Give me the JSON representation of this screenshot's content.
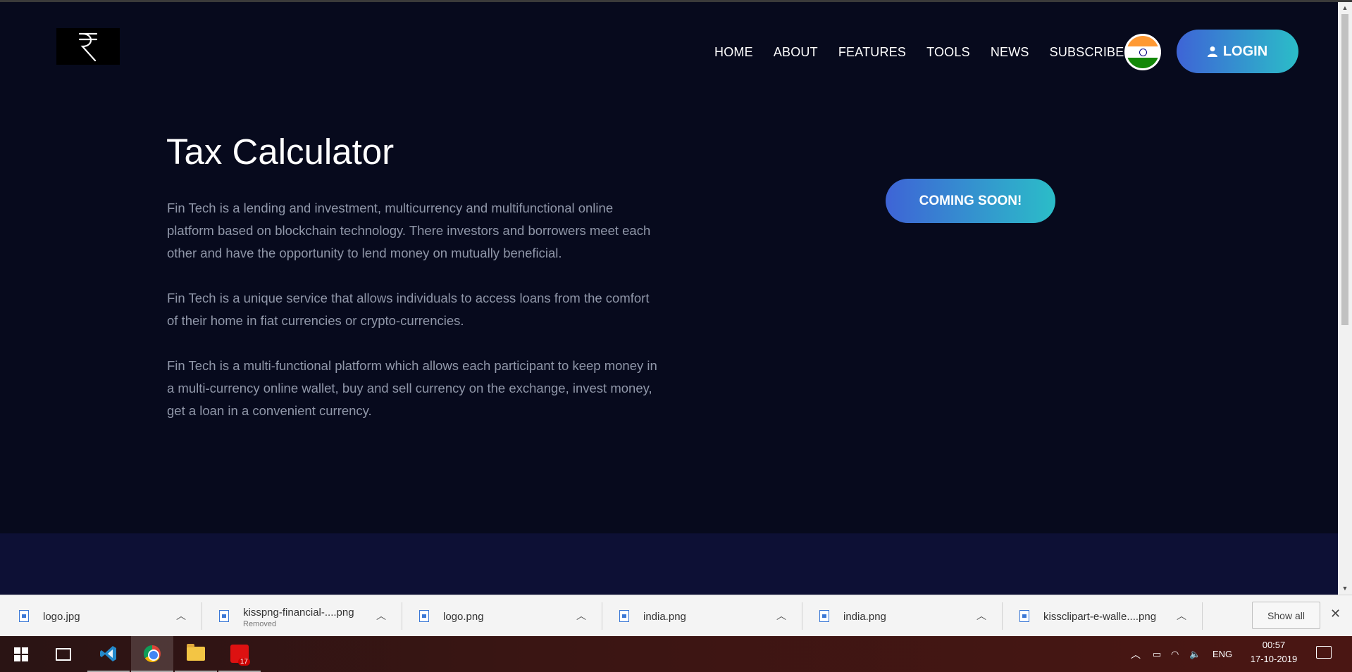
{
  "brand": {
    "logo_symbol": "₹"
  },
  "nav": {
    "items": [
      "HOME",
      "ABOUT",
      "FEATURES",
      "TOOLS",
      "NEWS",
      "SUBSCRIBE!"
    ],
    "login_label": "LOGIN"
  },
  "main": {
    "title": "Tax Calculator",
    "paragraphs": [
      "Fin Tech is a lending and investment, multicurrency and multifunctional online platform based on blockchain technology. There investors and borrowers meet each other and have the opportunity to lend money on mutually beneficial.",
      "Fin Tech is a unique service that allows individuals to access loans from the comfort of their home in fiat currencies or crypto-currencies.",
      "Fin Tech is a multi-functional platform which allows each participant to keep money in a multi-currency online wallet, buy and sell currency on the exchange, invest money, get a loan in a convenient currency."
    ],
    "coming_soon_label": "COMING SOON!"
  },
  "downloads": {
    "items": [
      {
        "name": "logo.jpg",
        "status": ""
      },
      {
        "name": "kisspng-financial-....png",
        "status": "Removed"
      },
      {
        "name": "logo.png",
        "status": ""
      },
      {
        "name": "india.png",
        "status": ""
      },
      {
        "name": "india.png",
        "status": ""
      },
      {
        "name": "kissclipart-e-walle....png",
        "status": ""
      }
    ],
    "show_all_label": "Show all"
  },
  "taskbar": {
    "language": "ENG",
    "time": "00:57",
    "date": "17-10-2019",
    "badge_count": "17"
  },
  "colors": {
    "background": "#070a1d",
    "accent_start": "#3e64d6",
    "accent_end": "#2bbdc8",
    "body_text": "#9097a9"
  }
}
